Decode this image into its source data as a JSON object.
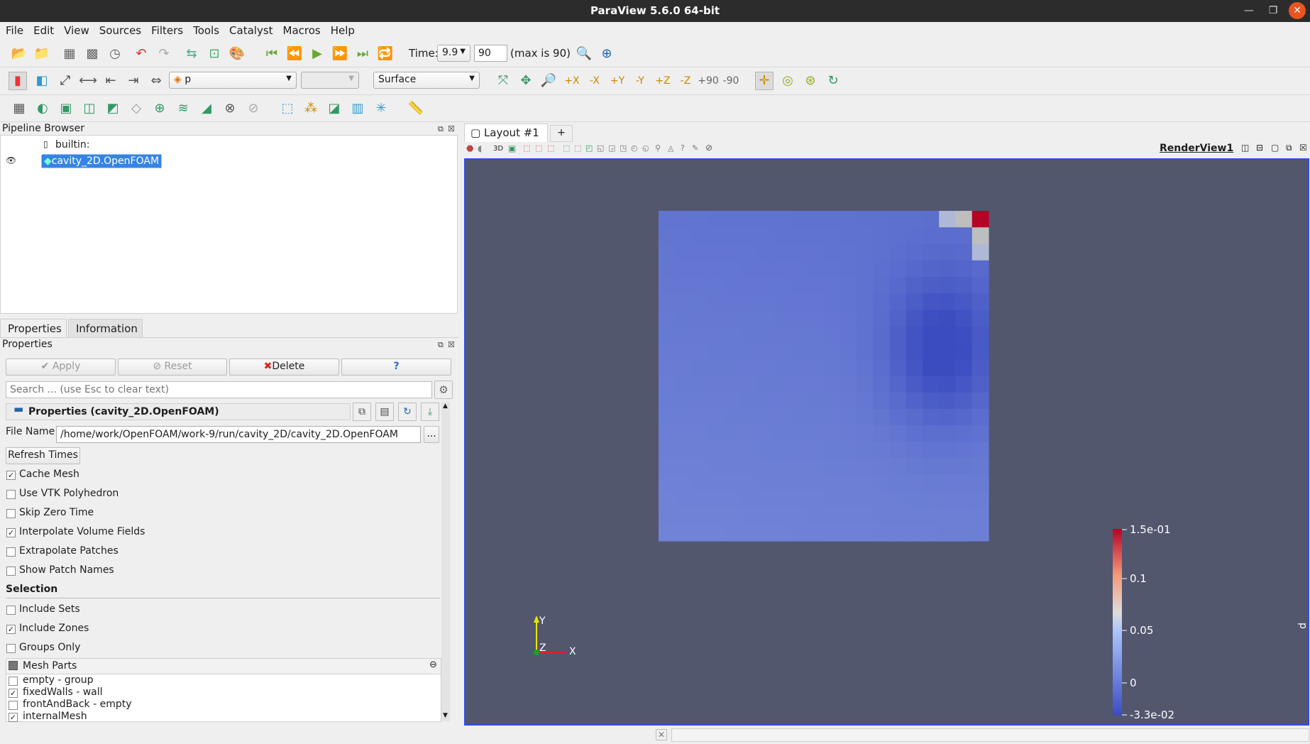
{
  "window": {
    "title": "ParaView 5.6.0 64-bit"
  },
  "menu": [
    "File",
    "Edit",
    "View",
    "Sources",
    "Filters",
    "Tools",
    "Catalyst",
    "Macros",
    "Help"
  ],
  "time": {
    "label": "Time:",
    "value": "9.9",
    "step": "90",
    "max_text": "(max is 90)"
  },
  "variable_select": "p",
  "representation_select": "Surface",
  "camera_labels": [
    "+X",
    "-X",
    "+Y",
    "-Y",
    "+Z",
    "-Z"
  ],
  "rotate_labels": [
    "+90",
    "-90"
  ],
  "pipeline": {
    "title": "Pipeline Browser",
    "root": "builtin:",
    "item": "cavity_2D.OpenFOAM"
  },
  "tabs": {
    "properties": "Properties",
    "information": "Information"
  },
  "properties": {
    "title": "Properties",
    "apply": "Apply",
    "reset": "Reset",
    "delete": "Delete",
    "help": "?",
    "search_placeholder": "Search ... (use Esc to clear text)",
    "section_title": "Properties (cavity_2D.OpenFOAM)",
    "file_name_label": "File Name",
    "file_name": "/home/work/OpenFOAM/work-9/run/cavity_2D/cavity_2D.OpenFOAM",
    "browse": "...",
    "refresh_times": "Refresh Times",
    "options": [
      {
        "label": "Cache Mesh",
        "checked": true
      },
      {
        "label": "Use VTK Polyhedron",
        "checked": false
      },
      {
        "label": "Skip Zero Time",
        "checked": false
      },
      {
        "label": "Interpolate Volume Fields",
        "checked": true
      },
      {
        "label": "Extrapolate Patches",
        "checked": false
      },
      {
        "label": "Show Patch Names",
        "checked": false
      }
    ],
    "selection_title": "Selection",
    "selection": [
      {
        "label": "Include Sets",
        "checked": false
      },
      {
        "label": "Include Zones",
        "checked": true
      },
      {
        "label": "Groups Only",
        "checked": false
      }
    ],
    "mesh_parts_title": "Mesh Parts",
    "mesh_parts": [
      {
        "label": "empty - group",
        "checked": false
      },
      {
        "label": "fixedWalls - wall",
        "checked": true
      },
      {
        "label": "frontAndBack - empty",
        "checked": false
      },
      {
        "label": "internalMesh",
        "checked": true
      }
    ]
  },
  "layout": {
    "tab": "Layout #1",
    "add": "+",
    "view_name": "RenderView1",
    "mode_3d": "3D"
  },
  "axes": {
    "y": "Y",
    "z": "Z",
    "x": "X"
  },
  "colorbar": {
    "title": "p",
    "labels": [
      "1.5e-01",
      "0.1",
      "0.05",
      "0",
      "-3.3e-02"
    ]
  },
  "colors": {
    "background": "#52576e",
    "high": "#b40426",
    "low": "#3b4cc0",
    "selection": "#3584e4"
  }
}
